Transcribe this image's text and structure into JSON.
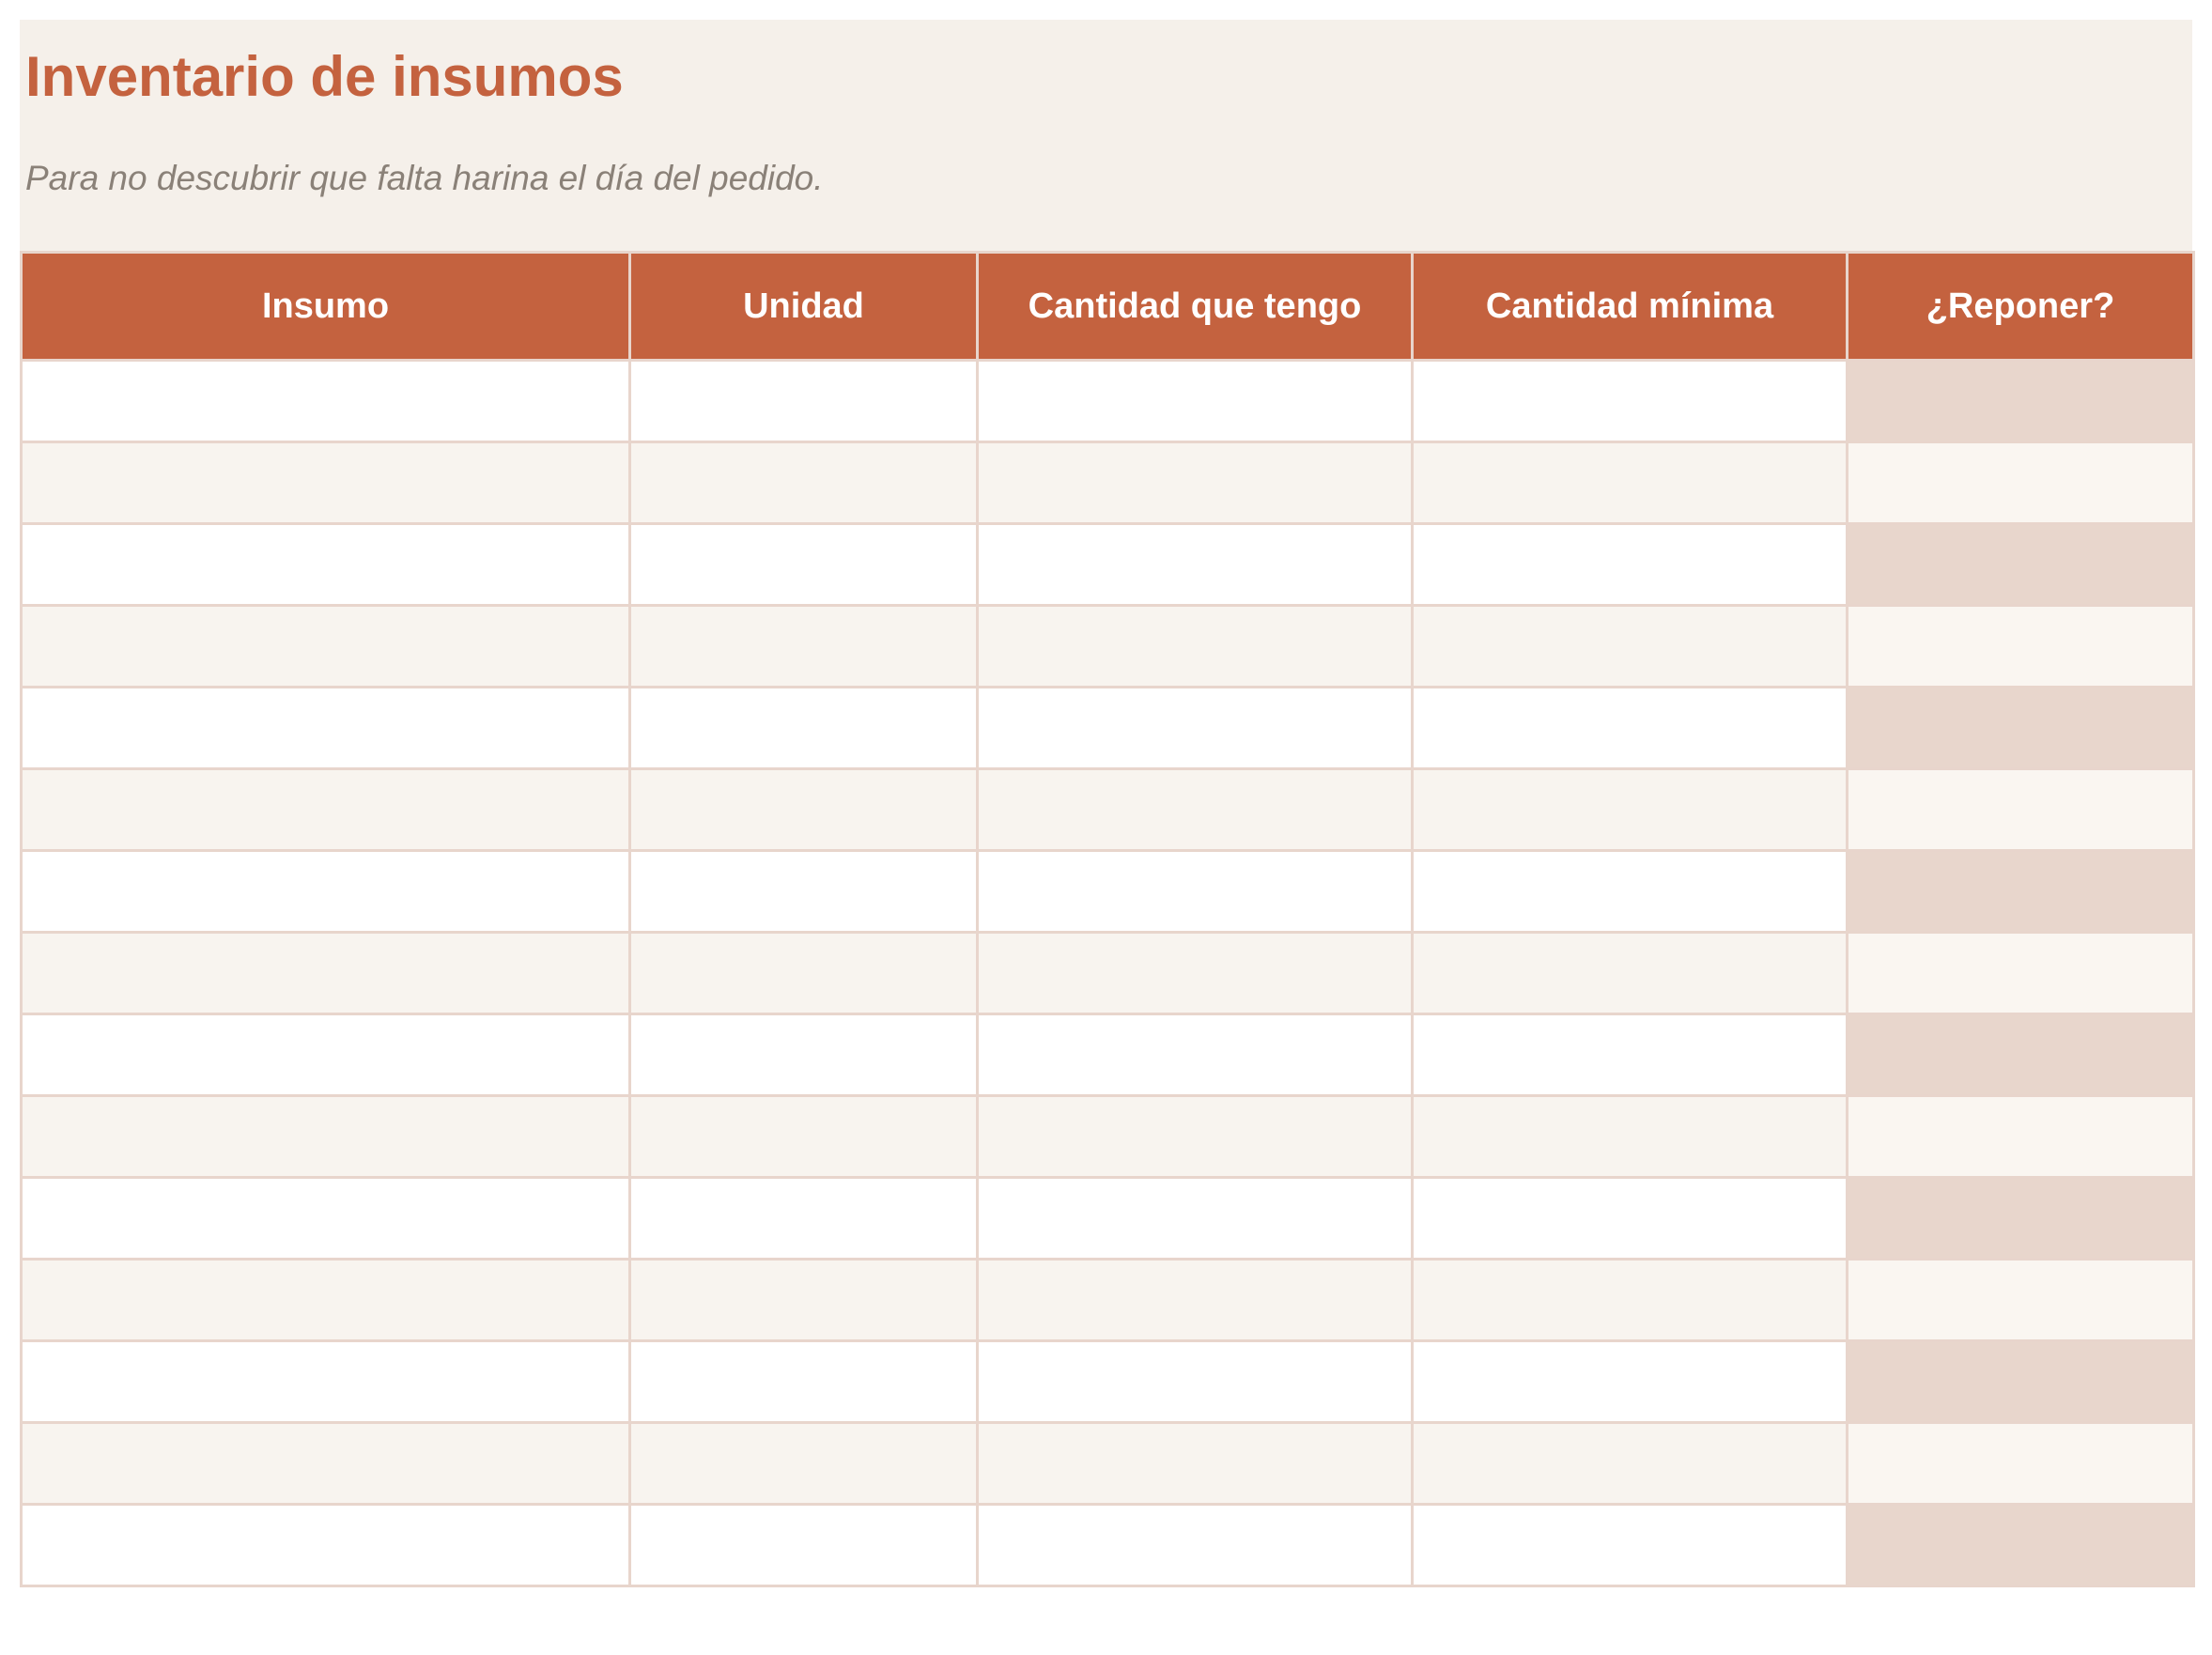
{
  "document": {
    "title": "Inventario de insumos",
    "subtitle": "Para no descubrir que falta harina el día del pedido.",
    "colors": {
      "accent": "#c4623f",
      "header_band": "#f5f0ea",
      "row_alt": "#f8f4ef",
      "reponer_highlight": "#e8d6cc",
      "border": "#e8d5cc"
    }
  },
  "table": {
    "columns": [
      "Insumo",
      "Unidad",
      "Cantidad que tengo",
      "Cantidad mínima",
      "¿Reponer?"
    ],
    "rows": [
      [
        "",
        "",
        "",
        "",
        ""
      ],
      [
        "",
        "",
        "",
        "",
        ""
      ],
      [
        "",
        "",
        "",
        "",
        ""
      ],
      [
        "",
        "",
        "",
        "",
        ""
      ],
      [
        "",
        "",
        "",
        "",
        ""
      ],
      [
        "",
        "",
        "",
        "",
        ""
      ],
      [
        "",
        "",
        "",
        "",
        ""
      ],
      [
        "",
        "",
        "",
        "",
        ""
      ],
      [
        "",
        "",
        "",
        "",
        ""
      ],
      [
        "",
        "",
        "",
        "",
        ""
      ],
      [
        "",
        "",
        "",
        "",
        ""
      ],
      [
        "",
        "",
        "",
        "",
        ""
      ],
      [
        "",
        "",
        "",
        "",
        ""
      ],
      [
        "",
        "",
        "",
        "",
        ""
      ],
      [
        "",
        "",
        "",
        "",
        ""
      ]
    ]
  }
}
